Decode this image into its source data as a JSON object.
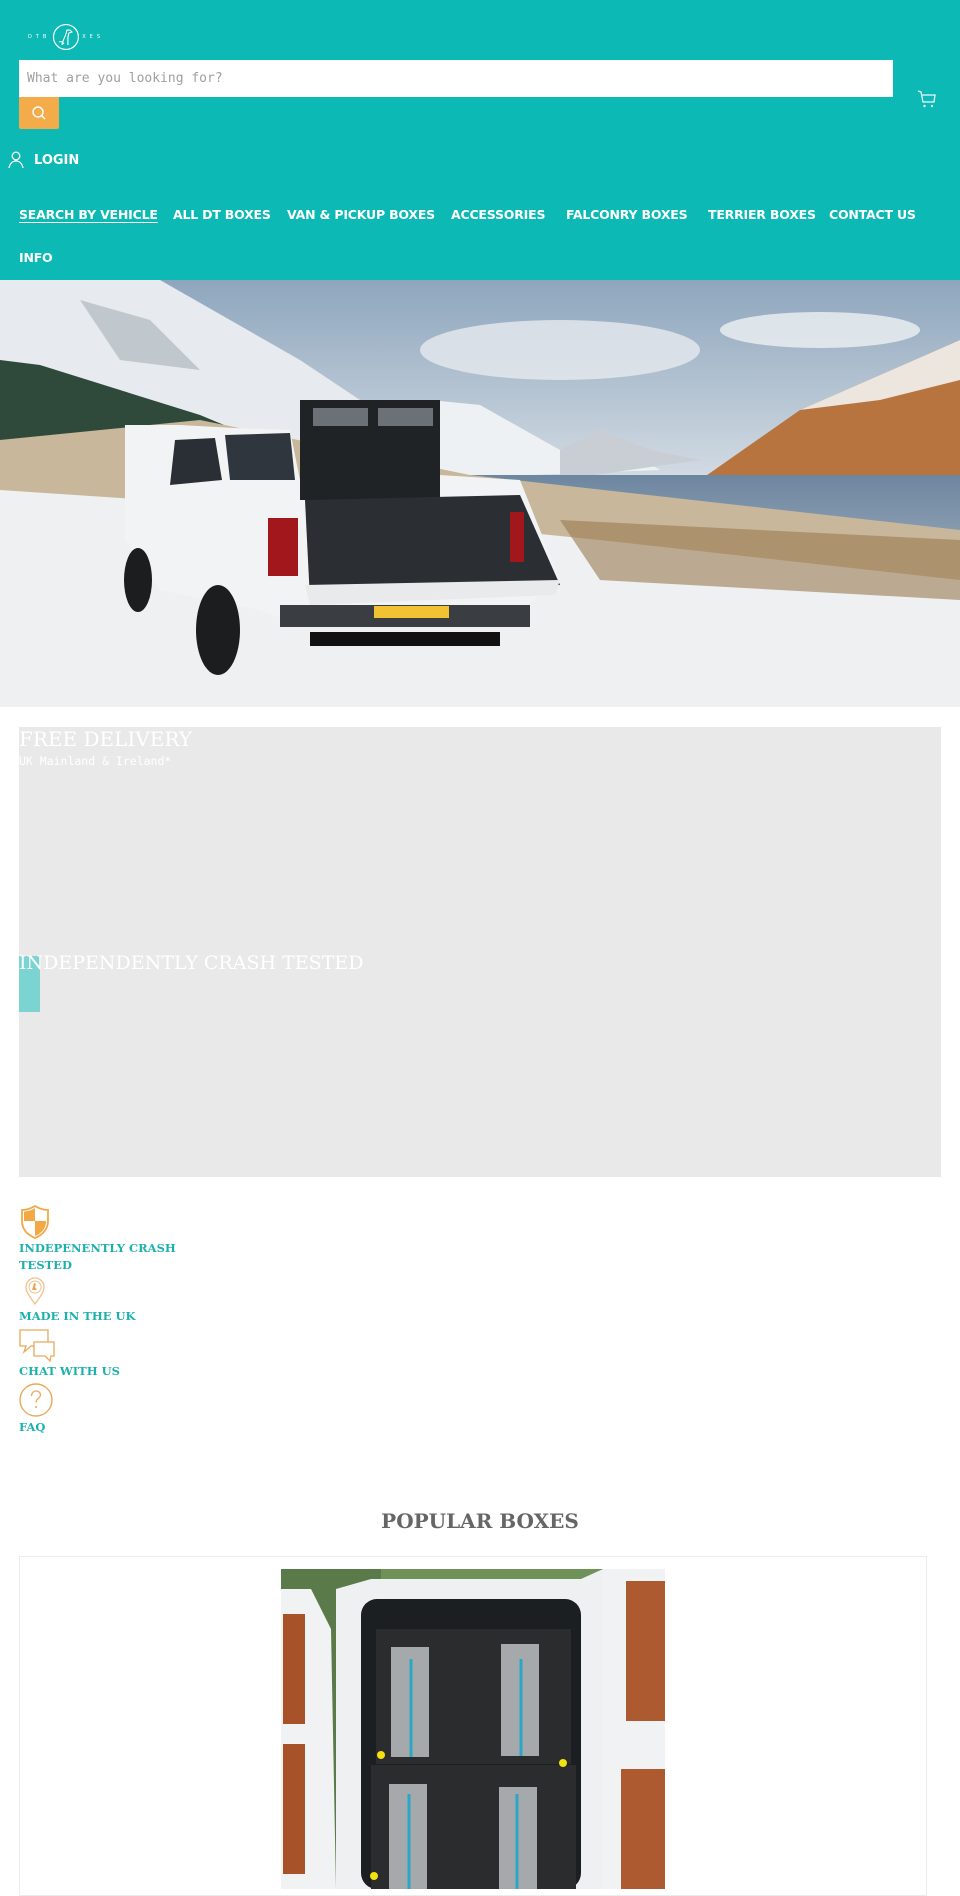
{
  "header": {
    "logo_text_left": "DTB",
    "logo_text_right": "XES",
    "logo_alt": "DT Boxes",
    "search": {
      "placeholder": "What are you looking for?",
      "value": ""
    },
    "search_icon": "search-icon",
    "cart_icon": "cart-icon",
    "login": {
      "icon": "user-icon",
      "label": "LOGIN"
    },
    "brand_color": "#0cb9b4",
    "accent_color": "#f4ab4a"
  },
  "nav": {
    "items": [
      {
        "label": "SEARCH BY VEHICLE",
        "active": true
      },
      {
        "label": "ALL DT BOXES"
      },
      {
        "label": "VAN & PICKUP BOXES"
      },
      {
        "label": "ACCESSORIES"
      },
      {
        "label": "FALCONRY BOXES"
      },
      {
        "label": "TERRIER BOXES"
      },
      {
        "label": "CONTACT US"
      },
      {
        "label": "INFO"
      }
    ]
  },
  "hero": {
    "alt": "White pickup truck with dog box in snowy mountain landscape beside a loch"
  },
  "promo": {
    "slides": [
      {
        "title": "FREE DELIVERY",
        "subtitle": "UK Mainland & Ireland*"
      },
      {
        "title": "INDEPENDENTLY CRASH TESTED"
      }
    ]
  },
  "features": [
    {
      "icon": "shield-icon",
      "label_line1": "INDEPENENTLY CRASH",
      "label_line2": "TESTED"
    },
    {
      "icon": "map-pin-icon",
      "label_line1": "MADE IN THE UK"
    },
    {
      "icon": "chat-icon",
      "label_line1": "CHAT WITH US"
    },
    {
      "icon": "help-icon",
      "label_line1": "FAQ"
    }
  ],
  "popular": {
    "title": "POPULAR BOXES",
    "products": [
      {
        "image_alt": "Double stacked dog boxes in the back of a white van"
      }
    ]
  }
}
